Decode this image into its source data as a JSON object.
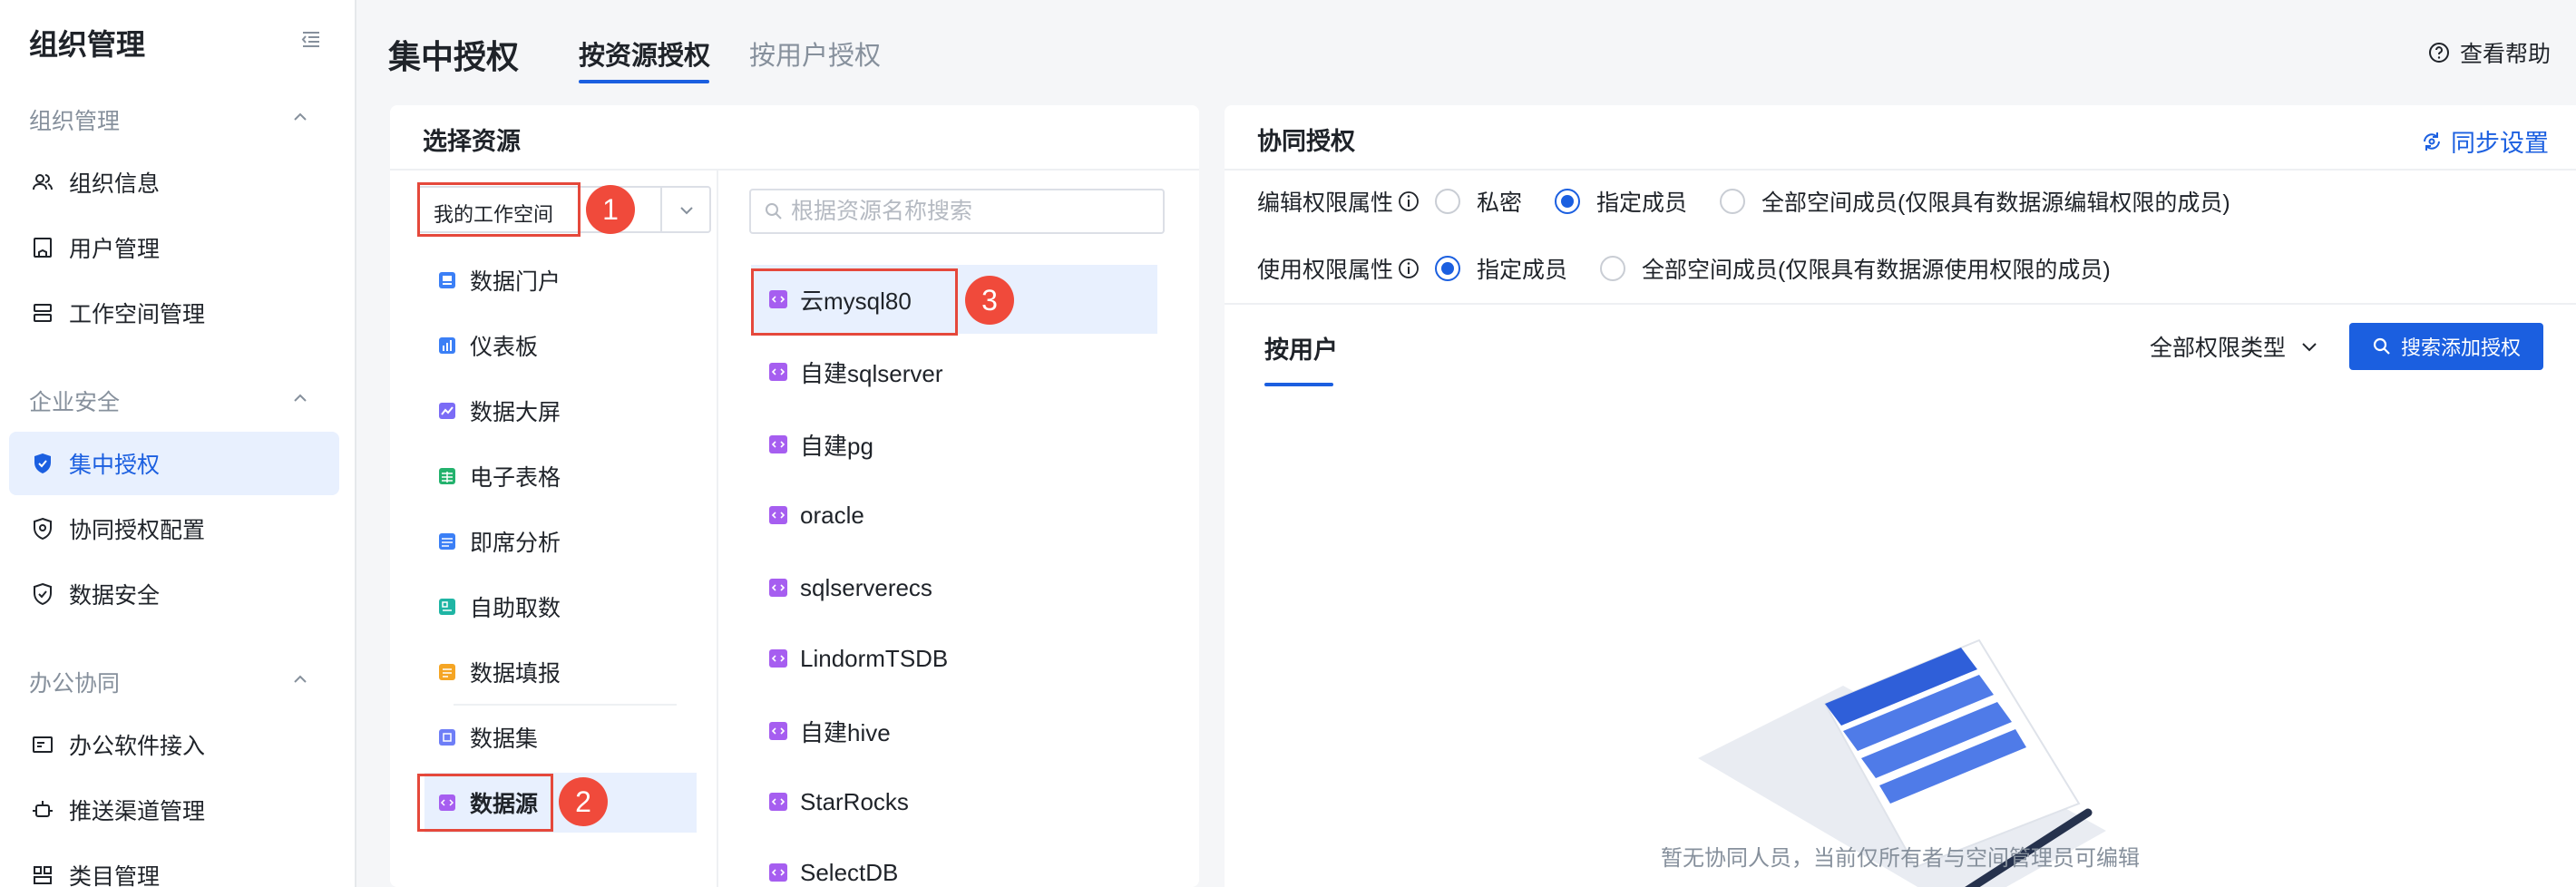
{
  "sidebar": {
    "title": "组织管理",
    "groups": [
      {
        "label": "组织管理",
        "items": [
          {
            "label": "组织信息",
            "icon": "users-icon"
          },
          {
            "label": "用户管理",
            "icon": "user-card-icon"
          },
          {
            "label": "工作空间管理",
            "icon": "workspace-icon"
          }
        ]
      },
      {
        "label": "企业安全",
        "items": [
          {
            "label": "集中授权",
            "icon": "shield-check-icon"
          },
          {
            "label": "协同授权配置",
            "icon": "shield-gear-icon"
          },
          {
            "label": "数据安全",
            "icon": "shield-icon"
          }
        ]
      },
      {
        "label": "办公协同",
        "items": [
          {
            "label": "办公软件接入",
            "icon": "plug-icon"
          },
          {
            "label": "推送渠道管理",
            "icon": "push-icon"
          },
          {
            "label": "类目管理",
            "icon": "category-icon"
          }
        ]
      }
    ]
  },
  "header": {
    "title": "集中授权",
    "tabs": [
      "按资源授权",
      "按用户授权"
    ],
    "help": "查看帮助"
  },
  "left_panel": {
    "title": "选择资源",
    "workspace_select": "我的工作空间",
    "search_placeholder": "根据资源名称搜索",
    "resource_types": [
      "数据门户",
      "仪表板",
      "数据大屏",
      "电子表格",
      "即席分析",
      "自助取数",
      "数据填报",
      "数据集",
      "数据源"
    ],
    "datasources": [
      "云mysql80",
      "自建sqlserver",
      "自建pg",
      "oracle",
      "sqlserverecs",
      "LindormTSDB",
      "自建hive",
      "StarRocks",
      "SelectDB"
    ],
    "badges": [
      "1",
      "2",
      "3"
    ]
  },
  "right_panel": {
    "title": "协同授权",
    "sync_settings": "同步设置",
    "edit_prop_label": "编辑权限属性",
    "edit_options": [
      "私密",
      "指定成员",
      "全部空间成员(仅限具有数据源编辑权限的成员)"
    ],
    "use_prop_label": "使用权限属性",
    "use_options": [
      "指定成员",
      "全部空间成员(仅限具有数据源使用权限的成员)"
    ],
    "user_tab": "按用户",
    "perm_type": "全部权限类型",
    "add_button": "搜索添加授权",
    "empty_text": "暂无协同人员，当前仅所有者与空间管理员可编辑"
  },
  "colors": {
    "accent": "#1b5fe0",
    "annotation_red": "#e5483b",
    "active_bg": "#e8f0fe"
  }
}
